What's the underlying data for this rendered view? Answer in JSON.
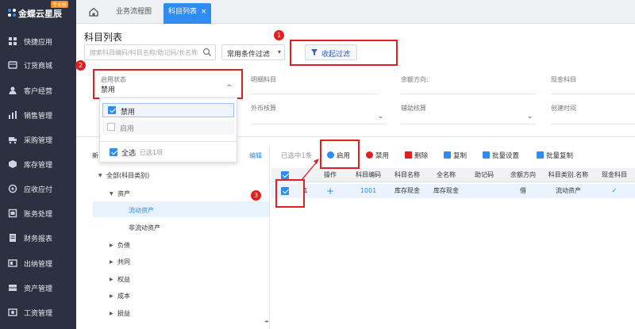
{
  "sidebar": {
    "logo": {
      "brand": "金蝶云星辰",
      "edition": "专业版"
    },
    "items": [
      {
        "label": "快捷应用",
        "icon": "grid-icon"
      },
      {
        "label": "订货商城",
        "icon": "cart-icon"
      },
      {
        "label": "客户经营",
        "icon": "person-icon"
      },
      {
        "label": "销售管理",
        "icon": "chart-icon"
      },
      {
        "label": "采购管理",
        "icon": "truck-icon"
      },
      {
        "label": "库存管理",
        "icon": "box-icon"
      },
      {
        "label": "应收应付",
        "icon": "circle-icon"
      },
      {
        "label": "账务处理",
        "icon": "book-icon"
      },
      {
        "label": "财务报表",
        "icon": "report-icon"
      },
      {
        "label": "出纳管理",
        "icon": "cash-icon"
      },
      {
        "label": "资产管理",
        "icon": "asset-icon"
      },
      {
        "label": "工资管理",
        "icon": "wage-icon"
      }
    ]
  },
  "tabs": [
    {
      "label": "业务流程图"
    },
    {
      "label": "科目列表",
      "close": "×"
    }
  ],
  "page": {
    "title": "科目列表"
  },
  "search": {
    "placeholder": "搜索科目编码/科目名称/助记码/长名称"
  },
  "filter_select": {
    "value": "常用条件过滤",
    "arrow": "▾"
  },
  "collapse_button": {
    "label": "收起过滤"
  },
  "filters": {
    "status": {
      "label": "启用状态",
      "value": "禁用",
      "arrow": "^"
    },
    "detail": {
      "label": "明细科目"
    },
    "balance_direction": {
      "label": "余额方向:"
    },
    "cash": {
      "label": "现金科目"
    },
    "foreign": {
      "label": "外币核算"
    },
    "auxiliary": {
      "label": "辅助核算"
    },
    "created": {
      "label": "创建时间"
    }
  },
  "dropdown": {
    "options": [
      {
        "label": "禁用",
        "checked": true
      },
      {
        "label": "启用",
        "checked": false
      }
    ],
    "select_all": "全选",
    "selected_count": "已选1项"
  },
  "annotations": {
    "one": "1",
    "two": "2",
    "three": "3"
  },
  "tree": {
    "new_label": "新",
    "edit_label": "编辑",
    "nodes": [
      {
        "label": "全部(科目类别)",
        "expanded": true
      },
      {
        "label": "资产",
        "expanded": true
      },
      {
        "label": "流动资产",
        "selected": true
      },
      {
        "label": "非流动资产"
      },
      {
        "label": "负债"
      },
      {
        "label": "共同"
      },
      {
        "label": "权益"
      },
      {
        "label": "成本"
      },
      {
        "label": "损益"
      }
    ]
  },
  "toolbar": {
    "selected_info": "已选中1条",
    "enable": "启用",
    "disable": "禁用",
    "delete": "删除",
    "copy": "复制",
    "batch_settings": "批量设置",
    "batch_copy": "批量复制"
  },
  "table": {
    "columns": [
      "操作",
      "科目编码",
      "科目名称",
      "全名称",
      "助记码",
      "余额方向",
      "科目类别.名称",
      "现金科目"
    ],
    "rows": [
      {
        "index": "1",
        "action": "+",
        "code": "1001",
        "name": "库存现金",
        "full_name": "库存现金",
        "mnemonic": "",
        "direction": "借",
        "category": "流动资产",
        "cash": "✓",
        "checked": true
      }
    ]
  },
  "colors": {
    "accent": "#2f8cf0",
    "sidebar": "#2b3140",
    "annotation": "#e02020"
  }
}
